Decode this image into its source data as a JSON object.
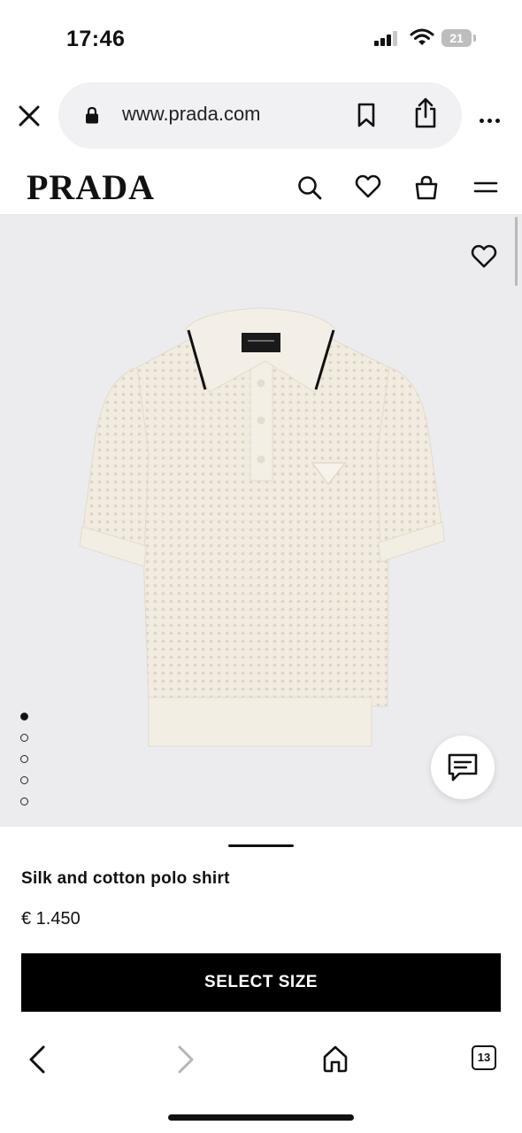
{
  "status": {
    "time": "17:46",
    "battery": "21"
  },
  "browser": {
    "url": "www.prada.com",
    "tab_count": "13"
  },
  "site": {
    "logo": "PRADA"
  },
  "product": {
    "name": "Silk and cotton polo shirt",
    "price": "€ 1.450",
    "cta_label": "SELECT SIZE",
    "image_count": 5,
    "active_image": 1
  },
  "icons": [
    "close-icon",
    "lock-icon",
    "bookmark-icon",
    "share-icon",
    "more-icon",
    "search-icon",
    "heart-icon",
    "bag-icon",
    "menu-icon",
    "chat-icon",
    "back-icon",
    "forward-icon",
    "home-icon",
    "tabs-icon"
  ],
  "colors": {
    "cta_bg": "#000000",
    "image_bg": "#ececee",
    "shirt": "#f1ebe0"
  }
}
